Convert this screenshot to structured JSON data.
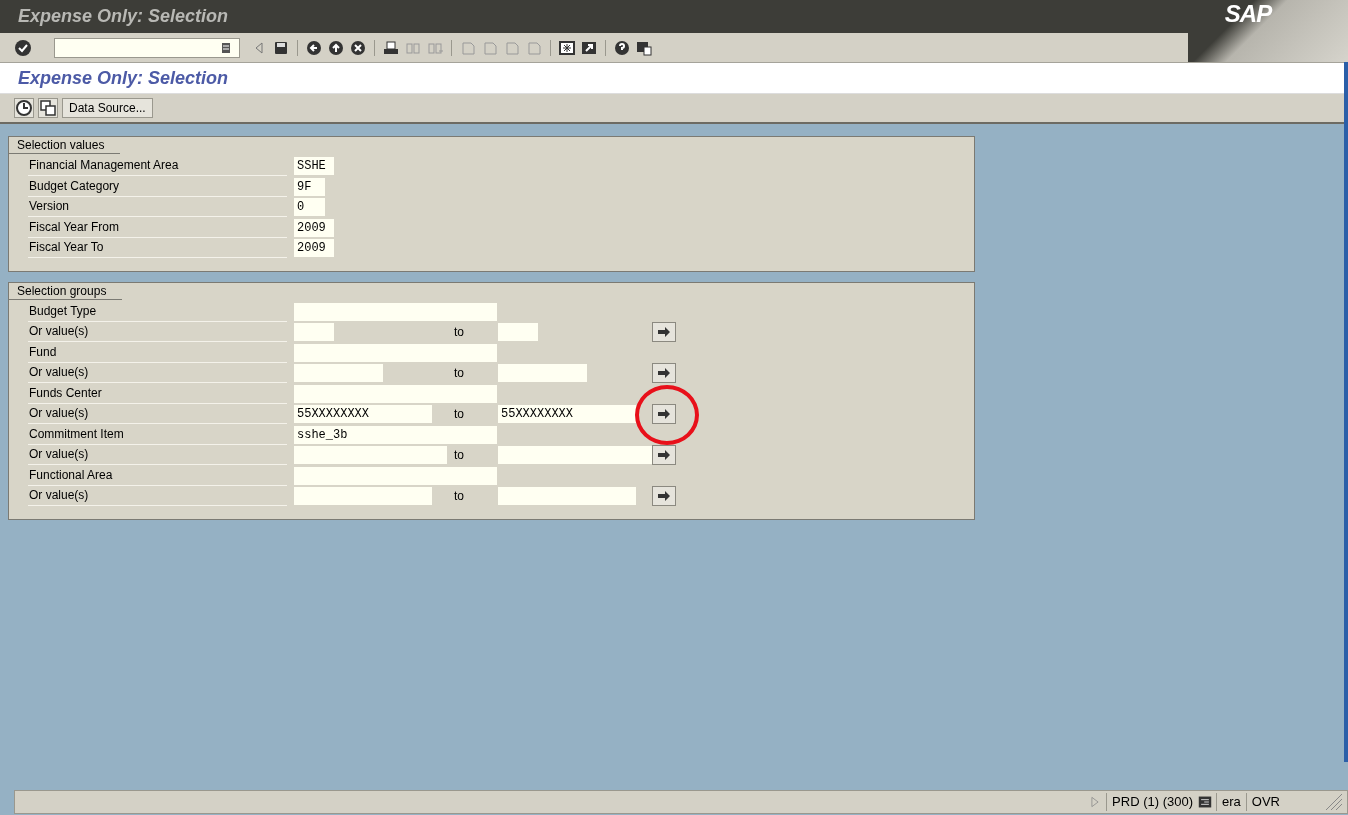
{
  "window": {
    "title": "Expense Only: Selection",
    "logo": "SAP"
  },
  "screen_title": "Expense Only: Selection",
  "app_toolbar": {
    "buttons": [
      "Data Source..."
    ]
  },
  "selection_values": {
    "title": "Selection values",
    "fields": [
      {
        "label": "Financial Management Area",
        "value": "SSHE"
      },
      {
        "label": "Budget Category",
        "value": "9F"
      },
      {
        "label": "Version",
        "value": "0"
      },
      {
        "label": "Fiscal Year From",
        "value": "2009"
      },
      {
        "label": "Fiscal Year To",
        "value": "2009"
      }
    ]
  },
  "selection_groups": {
    "title": "Selection groups",
    "groups": [
      {
        "label": "Budget Type",
        "or_label": "Or value(s)",
        "to_label": "to",
        "highlighted": false
      },
      {
        "label": "Fund",
        "or_label": "Or value(s)",
        "to_label": "to",
        "highlighted": false
      },
      {
        "label": "Funds Center",
        "or_label": "Or value(s)",
        "from": "55XXXXXXXX",
        "to_label": "to",
        "to": "55XXXXXXXX",
        "highlighted": true
      },
      {
        "label": "Commitment Item",
        "value": "sshe_3b",
        "or_label": "Or value(s)",
        "to_label": "to",
        "highlighted": false
      },
      {
        "label": "Functional Area",
        "or_label": "Or value(s)",
        "to_label": "to",
        "highlighted": false
      }
    ]
  },
  "status_bar": {
    "system": "PRD (1) (300)",
    "server": "era",
    "mode": "OVR"
  }
}
